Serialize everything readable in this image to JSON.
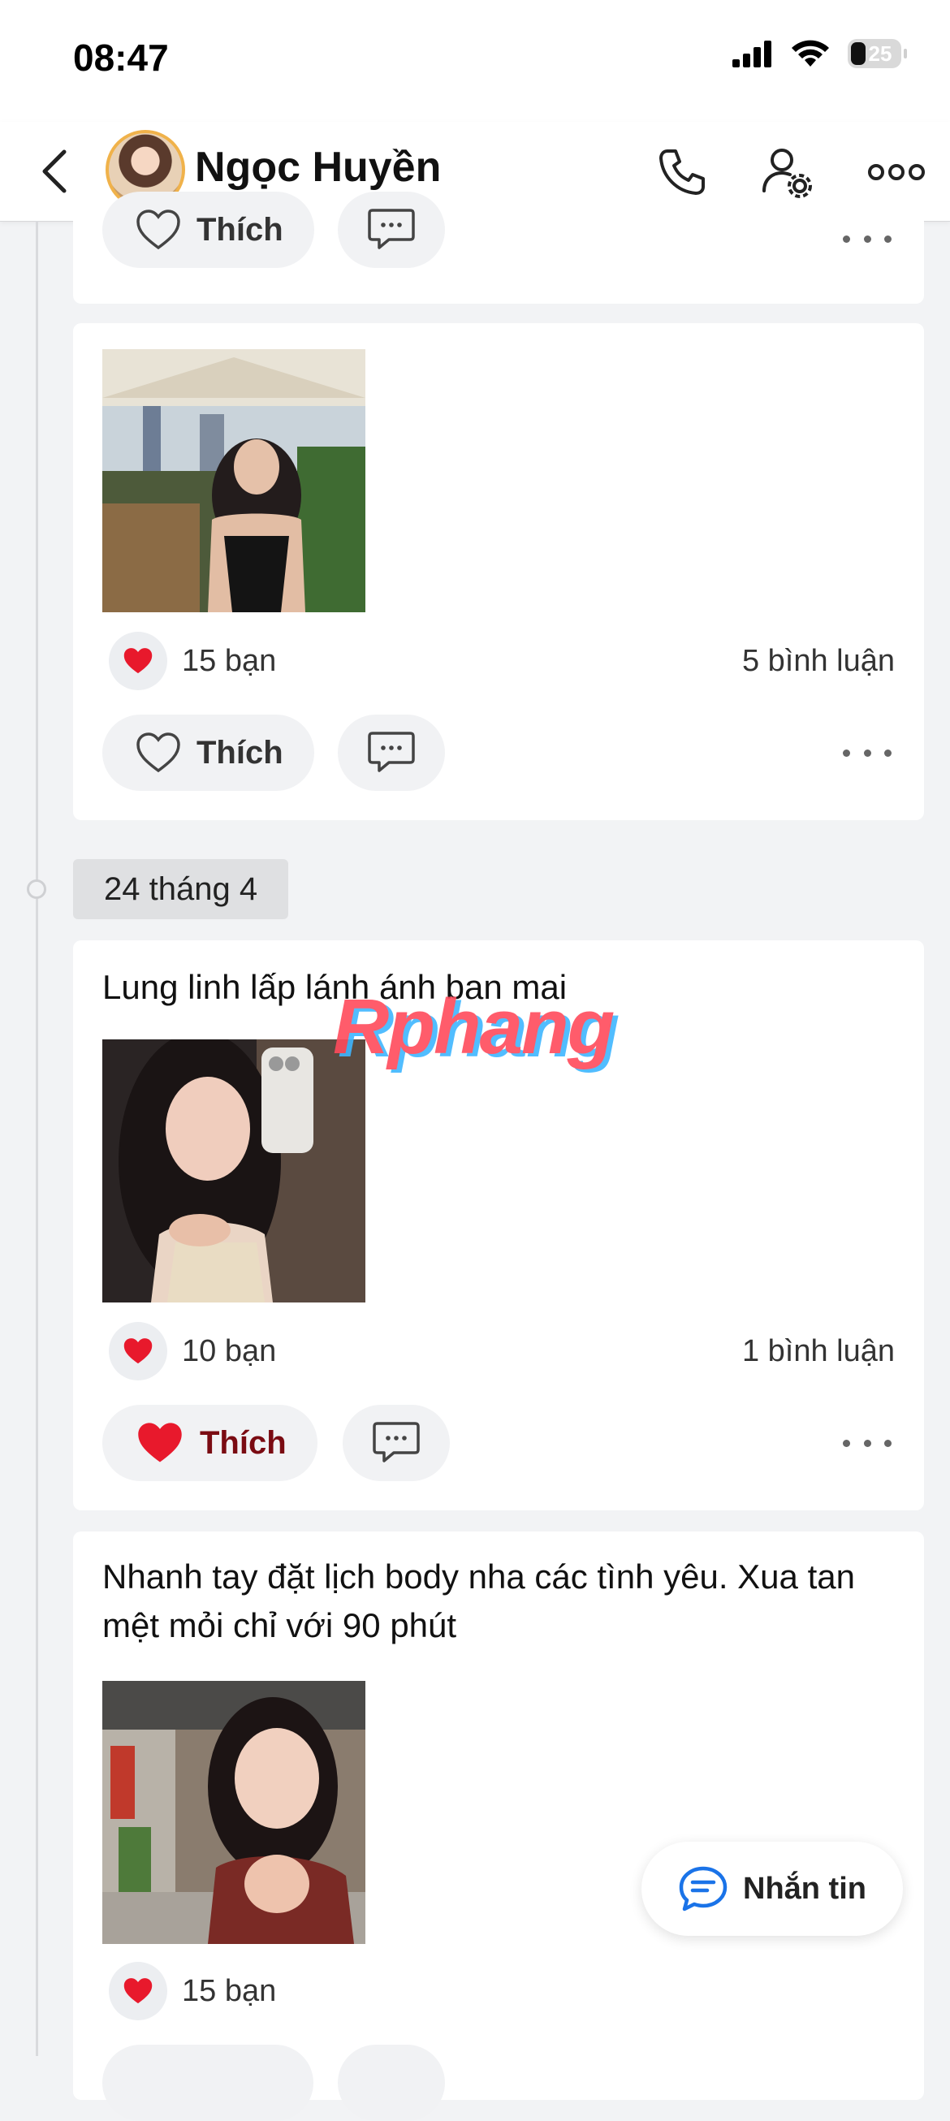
{
  "status_bar": {
    "time": "08:47",
    "battery": "25"
  },
  "header": {
    "name": "Ngọc Huyền"
  },
  "posts": [
    {
      "actions": {
        "like_label": "Thích"
      }
    },
    {
      "reactions": {
        "count": "15 bạn",
        "comments": "5 bình luận"
      },
      "actions": {
        "like_label": "Thích"
      }
    },
    {
      "text": "Lung linh lấp lánh ánh ban mai",
      "reactions": {
        "count": "10 bạn",
        "comments": "1 bình luận"
      },
      "actions": {
        "like_label": "Thích",
        "liked": true
      }
    },
    {
      "text": "Nhanh tay đặt lịch body nha các tình yêu. Xua tan mệt mỏi chỉ với 90 phút",
      "reactions": {
        "count": "15 bạn"
      }
    }
  ],
  "date_separator": "24 tháng 4",
  "watermark": "Rphang",
  "fab": {
    "label": "Nhắn tin"
  },
  "colors": {
    "accent_blue": "#1a73e8",
    "heart_red": "#e8192c",
    "liked_text": "#7a0b12"
  }
}
